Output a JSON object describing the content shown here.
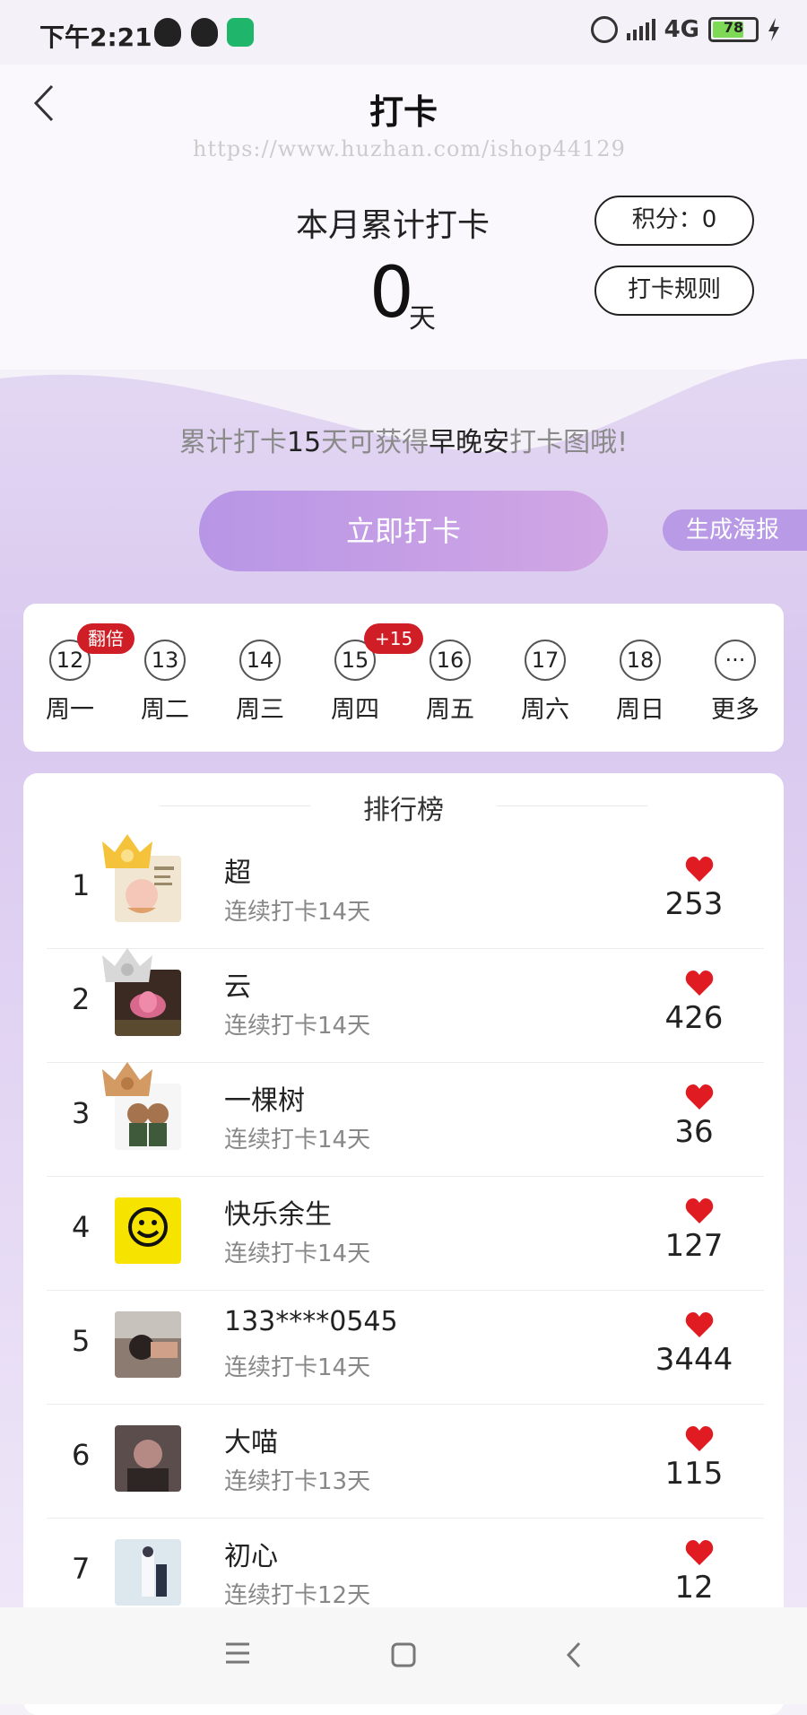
{
  "status_bar": {
    "time": "下午2:21",
    "network": "4G",
    "battery": "78",
    "battery_level": 0.78,
    "icons": [
      "qq-icon",
      "qq-icon",
      "app-icon",
      "alarm-icon",
      "signal-icon",
      "battery-icon",
      "charging-icon"
    ]
  },
  "nav": {
    "title": "打卡",
    "watermark": "https://www.huzhan.com/ishop44129"
  },
  "summary": {
    "month_title": "本月累计打卡",
    "count": "0",
    "unit": "天",
    "points_btn": "积分：0",
    "rules_btn": "打卡规则"
  },
  "hint": {
    "p1": "累计打卡",
    "days": "15",
    "p2": "天可获得",
    "reward": "早晚安",
    "p3": "打卡图哦!"
  },
  "actions": {
    "checkin": "立即打卡",
    "poster": "生成海报"
  },
  "week": {
    "days": [
      {
        "num": "12",
        "label": "周一"
      },
      {
        "num": "13",
        "label": "周二"
      },
      {
        "num": "14",
        "label": "周三"
      },
      {
        "num": "15",
        "label": "周四"
      },
      {
        "num": "16",
        "label": "周五"
      },
      {
        "num": "17",
        "label": "周六"
      },
      {
        "num": "18",
        "label": "周日"
      },
      {
        "num": "···",
        "label": "更多"
      }
    ],
    "badge_double": "翻倍",
    "badge_plus": "+15"
  },
  "ranking": {
    "title": "排行榜",
    "rows": [
      {
        "rank": "1",
        "name": "超",
        "sub": "连续打卡14天",
        "score": "253"
      },
      {
        "rank": "2",
        "name": "云",
        "sub": "连续打卡14天",
        "score": "426"
      },
      {
        "rank": "3",
        "name": "一棵树",
        "sub": "连续打卡14天",
        "score": "36"
      },
      {
        "rank": "4",
        "name": "快乐余生",
        "sub": "连续打卡14天",
        "score": "127"
      },
      {
        "rank": "5",
        "name": "133****0545",
        "sub": "连续打卡14天",
        "score": "3444"
      },
      {
        "rank": "6",
        "name": "大喵",
        "sub": "连续打卡13天",
        "score": "115"
      },
      {
        "rank": "7",
        "name": "初心",
        "sub": "连续打卡12天",
        "score": "12"
      }
    ]
  },
  "colors": {
    "accent_purple": "#b99ae6",
    "badge_red": "#d01e26",
    "heart_red": "#e11b22"
  }
}
